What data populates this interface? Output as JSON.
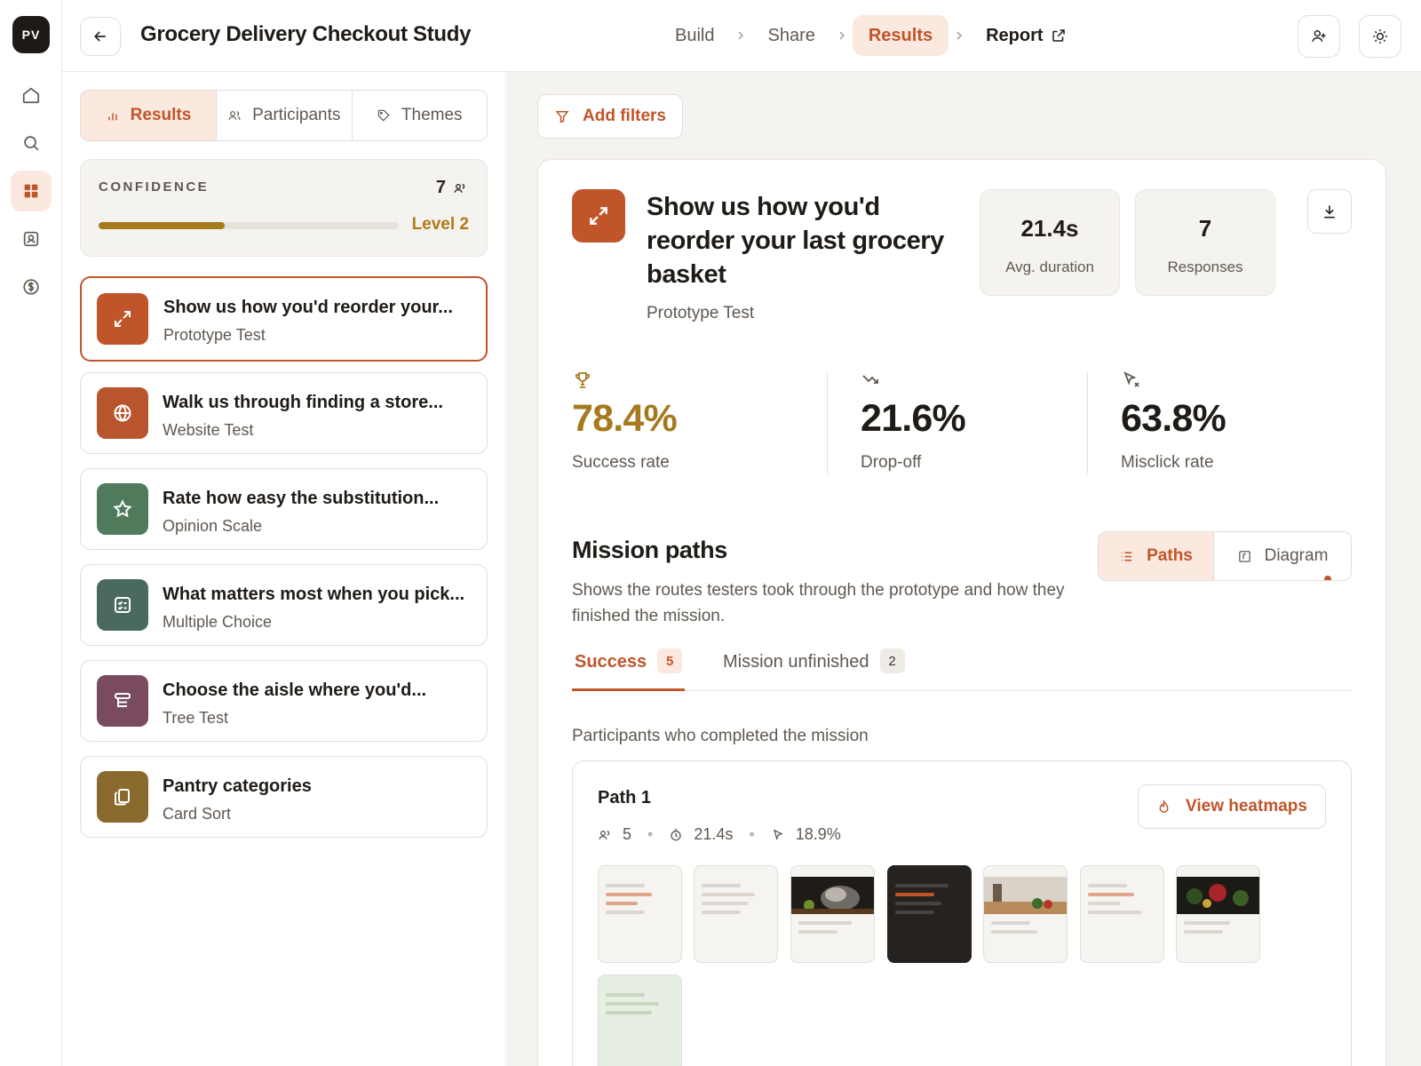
{
  "rail": {
    "logo": "PV",
    "items": [
      "home-icon",
      "search-icon",
      "grid-icon",
      "contacts-icon",
      "billing-icon"
    ],
    "active_index": 2
  },
  "header": {
    "title": "Grocery Delivery Checkout Study",
    "steps": [
      {
        "label": "Build"
      },
      {
        "label": "Share"
      },
      {
        "label": "Results"
      },
      {
        "label": "Report"
      }
    ],
    "active_step": "Results"
  },
  "sidebar": {
    "tabs": [
      {
        "label": "Results"
      },
      {
        "label": "Participants"
      },
      {
        "label": "Themes"
      }
    ],
    "confidence": {
      "label": "CONFIDENCE",
      "count": "7",
      "level": "Level 2",
      "progress": 0.42
    },
    "tasks": [
      {
        "title": "Show us how you'd reorder your...",
        "type": "Prototype Test",
        "color": "#c0552a",
        "icon": "expand-icon"
      },
      {
        "title": "Walk us through finding a store...",
        "type": "Website Test",
        "color": "#b8552c",
        "icon": "globe-icon"
      },
      {
        "title": "Rate how easy the substitution...",
        "type": "Opinion Scale",
        "color": "#4f7a5c",
        "icon": "star-icon"
      },
      {
        "title": "What matters most when you pick...",
        "type": "Multiple Choice",
        "color": "#4a6a60",
        "icon": "checklist-icon"
      },
      {
        "title": "Choose the aisle where you'd...",
        "type": "Tree Test",
        "color": "#7a4a5e",
        "icon": "tree-icon"
      },
      {
        "title": "Pantry categories",
        "type": "Card Sort",
        "color": "#8a6a2c",
        "icon": "cards-icon"
      }
    ]
  },
  "main": {
    "filter_label": "Add filters",
    "task": {
      "title": "Show us how you'd reorder your last grocery basket",
      "type": "Prototype Test",
      "avg_duration": "21.4s",
      "avg_duration_label": "Avg. duration",
      "responses": "7",
      "responses_label": "Responses"
    },
    "metrics": [
      {
        "value": "78.4%",
        "label": "Success rate"
      },
      {
        "value": "21.6%",
        "label": "Drop-off"
      },
      {
        "value": "63.8%",
        "label": "Misclick rate"
      }
    ],
    "mission": {
      "title": "Mission paths",
      "description": "Shows the routes testers took through the prototype and how they finished the mission.",
      "view_options": [
        "Paths",
        "Diagram"
      ]
    },
    "outcome_tabs": [
      {
        "label": "Success",
        "count": "5"
      },
      {
        "label": "Mission unfinished",
        "count": "2"
      }
    ],
    "participants_note": "Participants who completed the mission",
    "path": {
      "title": "Path 1",
      "participants": "5",
      "duration": "21.4s",
      "misclick": "18.9%",
      "heatmaps_label": "View heatmaps"
    }
  },
  "colors": {
    "accent": "#c0552a",
    "accent_soft": "#fbe8de",
    "gold": "#a57a1d"
  }
}
